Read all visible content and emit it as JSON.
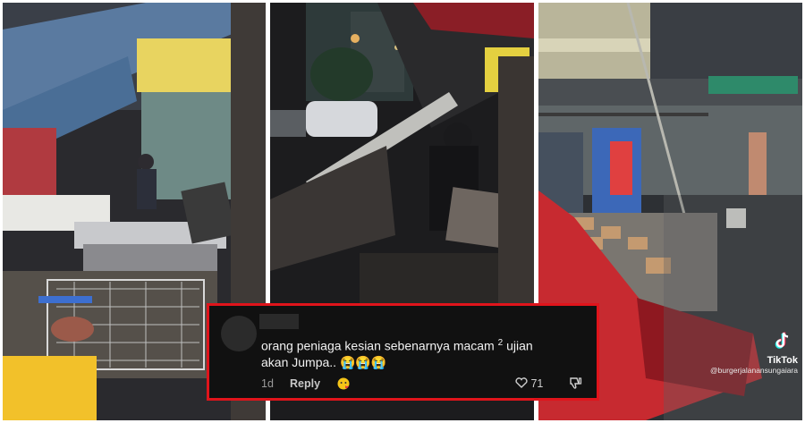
{
  "comment": {
    "text_main": "orang peniaga kesian sebenarnya macam",
    "superscript": "2",
    "text_rest": "ujian",
    "text_line2": "akan Jumpa..",
    "emojis": "😭😭😭",
    "age": "1d",
    "reply_label": "Reply",
    "like_count": "71"
  },
  "watermark": {
    "brand": "TikTok",
    "handle": "@burgerjalanansungaiara"
  },
  "icons": [
    "avatar",
    "reaction-emoji-icon",
    "heart-icon",
    "dislike-icon",
    "tiktok-logo-icon"
  ]
}
